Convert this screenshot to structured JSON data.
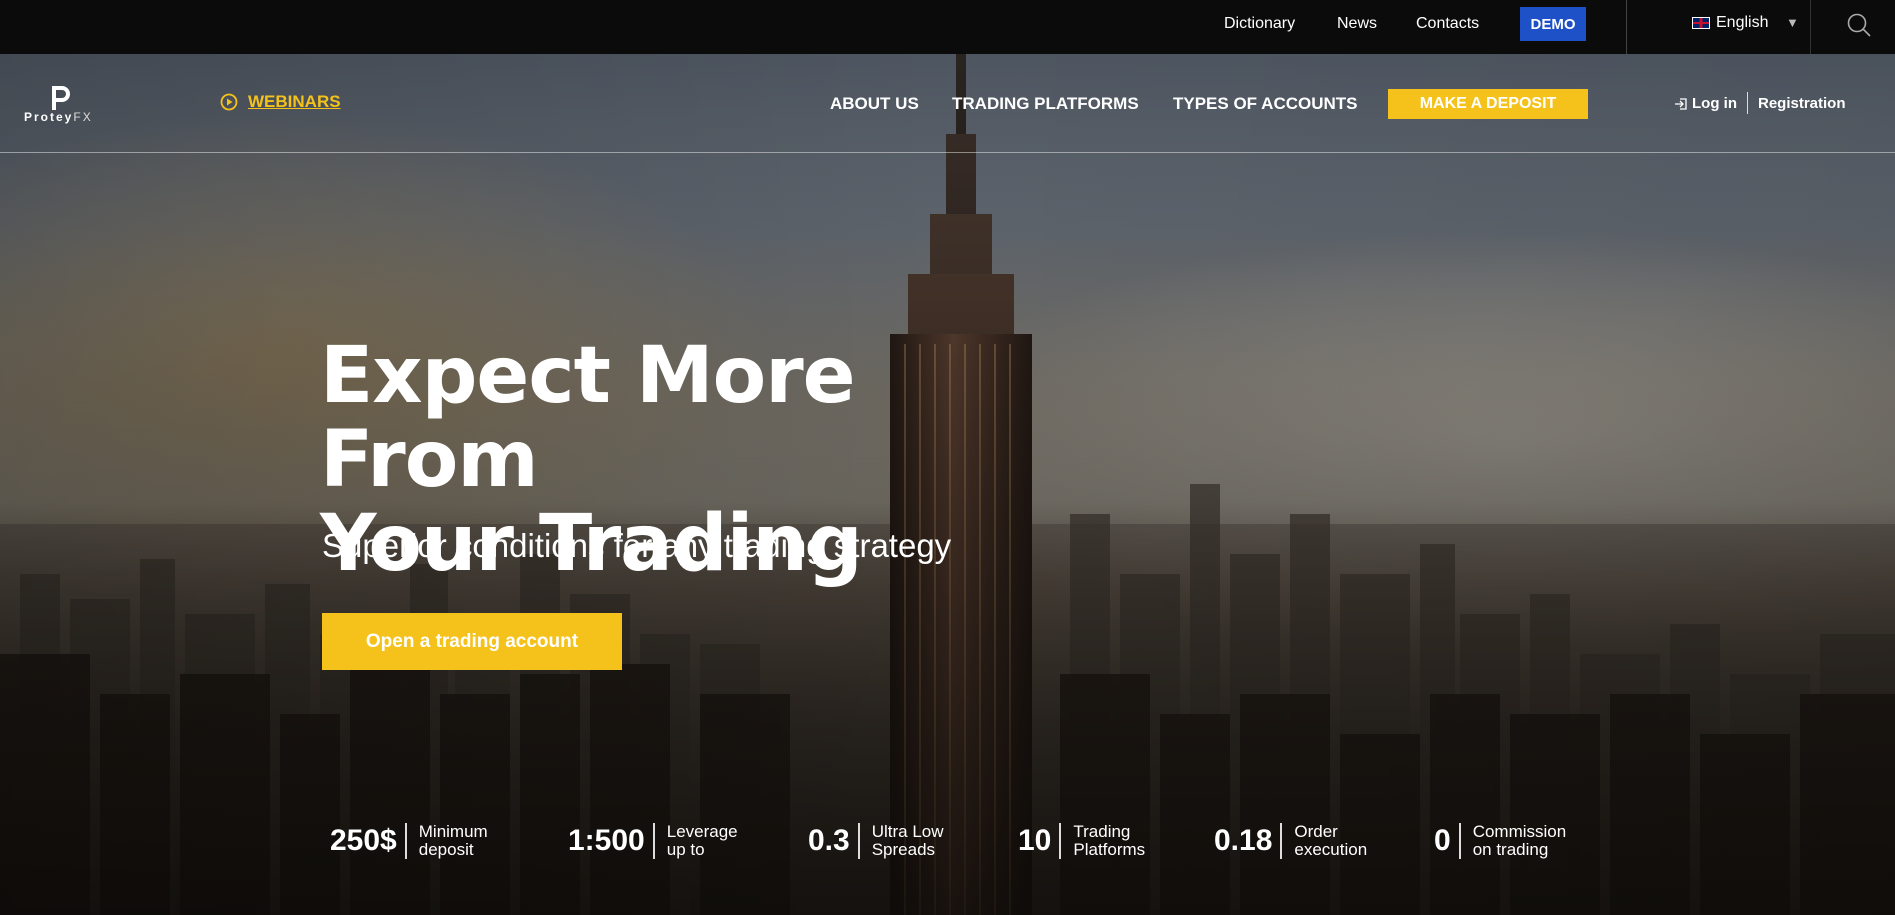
{
  "topbar": {
    "links": [
      "Dictionary",
      "News",
      "Contacts"
    ],
    "demo_label": "DEMO",
    "language": "English"
  },
  "brand": {
    "name": "Protey",
    "suffix": "FX"
  },
  "nav": {
    "webinars_label": "WEBINARS",
    "items": [
      "ABOUT US",
      "TRADING PLATFORMS",
      "TYPES OF ACCOUNTS"
    ],
    "deposit_label": "MAKE A DEPOSIT",
    "login_label": "Log in",
    "register_label": "Registration"
  },
  "hero": {
    "headline_line1": "Expect More From",
    "headline_line2": "Your Trading",
    "subhead": "Superior conditions for any trading strategy",
    "cta_label": "Open a trading account"
  },
  "stats": [
    {
      "value": "250$",
      "label1": "Minimum",
      "label2": "deposit"
    },
    {
      "value": "1:500",
      "label1": "Leverage",
      "label2": "up to"
    },
    {
      "value": "0.3",
      "label1": "Ultra Low",
      "label2": "Spreads"
    },
    {
      "value": "10",
      "label1": "Trading",
      "label2": "Platforms"
    },
    {
      "value": "0.18",
      "label1": "Order",
      "label2": "execution"
    },
    {
      "value": "0",
      "label1": "Commission",
      "label2": "on trading"
    }
  ],
  "colors": {
    "accent_yellow": "#f5c21b",
    "demo_blue": "#1e50c8",
    "topbar_bg": "#0b0b0b"
  },
  "icons": {
    "webinar": "play-circle-icon",
    "login": "login-arrow-icon",
    "search": "search-icon",
    "language": "uk-flag-icon",
    "dropdown": "caret-down-icon"
  }
}
